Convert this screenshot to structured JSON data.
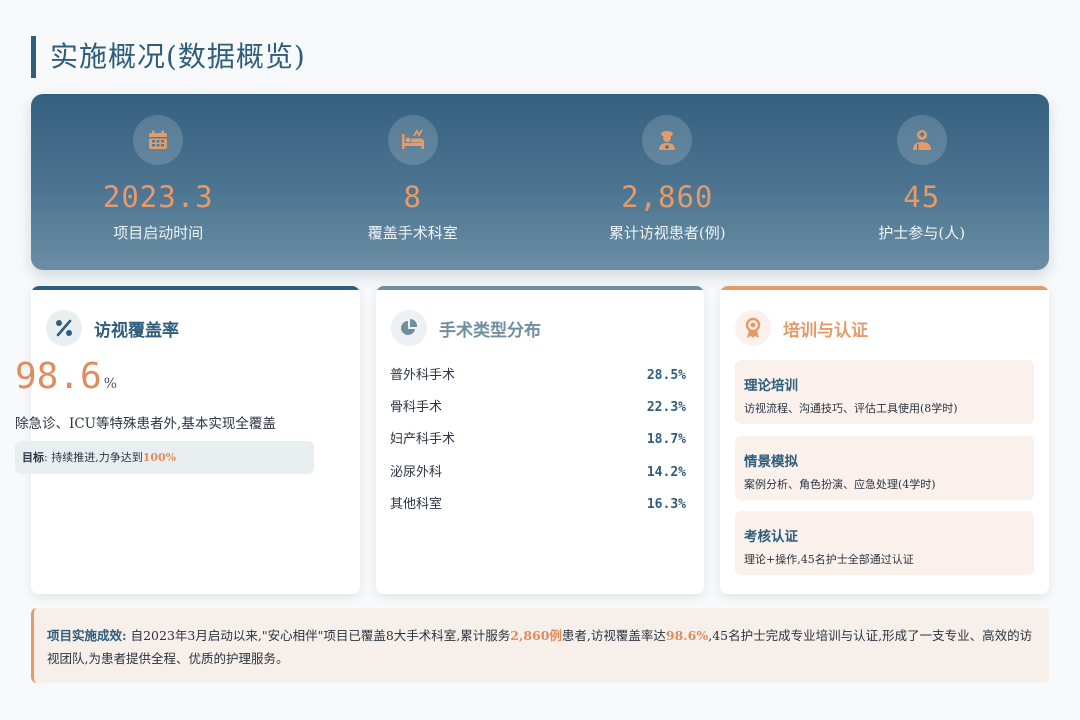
{
  "page": {
    "title": "实施概况(数据概览)"
  },
  "stats": [
    {
      "icon": "calendar-icon",
      "value": "2023.3",
      "label": "项目启动时间"
    },
    {
      "icon": "bed-icon",
      "value": "8",
      "label": "覆盖手术科室"
    },
    {
      "icon": "nurse-icon",
      "value": "2,860",
      "label": "累计访视患者(例)"
    },
    {
      "icon": "user-md-icon",
      "value": "45",
      "label": "护士参与(人)"
    }
  ],
  "coverage": {
    "icon": "percent-icon",
    "title": "访视覆盖率",
    "value": "98.6",
    "unit": "%",
    "description": "除急诊、ICU等特殊患者外,基本实现全覆盖",
    "goal_label": "目标",
    "goal_text": ": 持续推进,力争达到",
    "goal_value": "100%"
  },
  "surgery": {
    "icon": "pie-chart-icon",
    "title": "手术类型分布",
    "items": [
      {
        "name": "普外科手术",
        "pct": "28.5%"
      },
      {
        "name": "骨科手术",
        "pct": "22.3%"
      },
      {
        "name": "妇产科手术",
        "pct": "18.7%"
      },
      {
        "name": "泌尿外科",
        "pct": "14.2%"
      },
      {
        "name": "其他科室",
        "pct": "16.3%"
      }
    ]
  },
  "training": {
    "icon": "award-icon",
    "title": "培训与认证",
    "items": [
      {
        "title": "理论培训",
        "desc": "访视流程、沟通技巧、评估工具使用(8学时)"
      },
      {
        "title": "情景模拟",
        "desc": "案例分析、角色扮演、应急处理(4学时)"
      },
      {
        "title": "考核认证",
        "desc": "理论+操作,45名护士全部通过认证"
      }
    ]
  },
  "summary": {
    "label": "项目实施成效:",
    "part1": " 自2023年3月启动以来,\"安心相伴\"项目已覆盖8大手术科室,累计服务",
    "hl1": "2,860例",
    "part2": "患者,访视覆盖率达",
    "hl2": "98.6%",
    "part3": ",45名护士完成专业培训与认证,形成了一支专业、高效的访视团队,为患者提供全程、优质的护理服务。"
  },
  "colors": {
    "primary": "#2f5d7c",
    "accent": "#e59a6a",
    "muted": "#6f8e9f"
  }
}
